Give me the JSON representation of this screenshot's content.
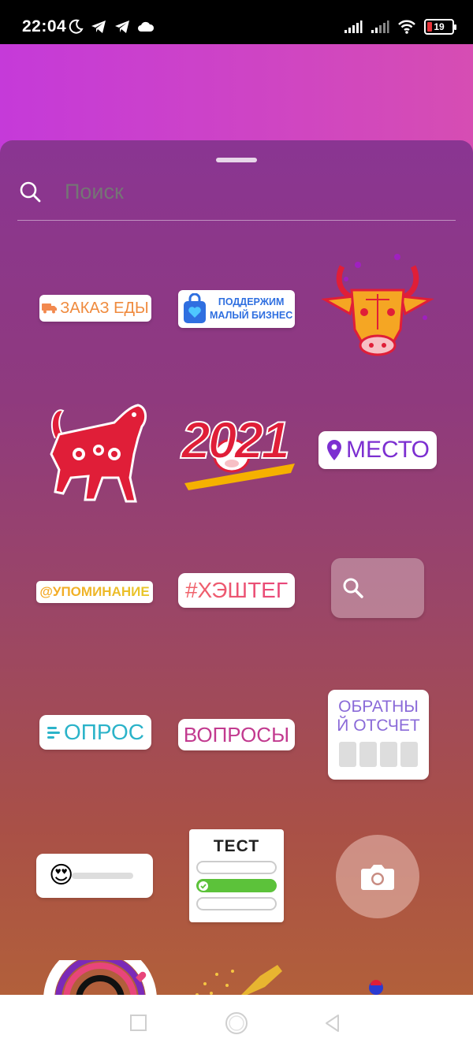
{
  "status_bar": {
    "time": "22:04",
    "battery_level": "19",
    "battery_fraction": 0.19,
    "icons": [
      "moon-icon",
      "telegram-icon",
      "telegram-icon",
      "cloud-icon",
      "signal-icon",
      "signal-icon",
      "wifi-icon",
      "battery-icon"
    ]
  },
  "search": {
    "placeholder": "Поиск"
  },
  "stickers": {
    "food_order": "ЗАКАЗ ЕДЫ",
    "small_business": [
      "ПОДДЕРЖИМ",
      "МАЛЫЙ БИЗНЕС"
    ],
    "year": "2021",
    "location": "МЕСТО",
    "mention": "@УПОМИНАНИЕ",
    "hashtag": "#ХЭШТЕГ",
    "poll": "ОПРОС",
    "questions": "ВОПРОСЫ",
    "countdown": [
      "ОБРАТНЫ",
      "Й ОТСЧЕТ"
    ],
    "quiz": "ТЕСТ",
    "emoji_slider_emoji": "😍"
  },
  "colors": {
    "sheet_top": "#8a3592",
    "sheet_bottom": "#b2603a",
    "location_purple": "#7c2fd1",
    "hashtag_pink": "#e8457a",
    "poll_teal": "#2bb3c9",
    "questions_magenta": "#c23a8f",
    "ox_red": "#e01e38",
    "ox_gold": "#f5a623",
    "quiz_green": "#5cc23a"
  },
  "nav_bar": {
    "buttons": [
      "recent-apps-button",
      "home-button",
      "back-button"
    ]
  }
}
